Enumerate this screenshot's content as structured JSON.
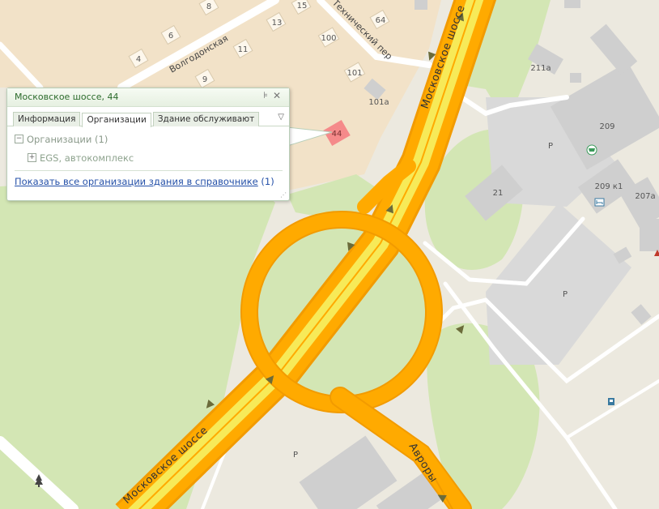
{
  "map": {
    "road_labels": {
      "moskovskoe_top": "Московское шоссе",
      "moskovskoe_bottom": "Московское шоссе",
      "avrory": "Авроры",
      "volgodonskaya": "Волгодонская",
      "tehnicheskiy": "Технический пер"
    },
    "house_numbers": [
      "8",
      "15",
      "13",
      "64",
      "6",
      "100",
      "4",
      "11",
      "101",
      "9",
      "101а",
      "44",
      "211а",
      "209",
      "21",
      "209 к1",
      "207а"
    ],
    "parking_labels": [
      "P",
      "P",
      "P"
    ],
    "colors": {
      "land": "#ece9df",
      "green_area": "#d3e6b4",
      "residential": "#f2e2c8",
      "building": "#cfcfcf",
      "highway": "#ffaa00",
      "highway_casing": "#f29b00",
      "highway_inner": "#f7ea58",
      "minor_road": "#ffffff",
      "selected_building": "#f58a8a"
    }
  },
  "popup": {
    "title": "Московское шоссе, 44",
    "pin_icon": "pin-icon",
    "close_icon": "close-icon",
    "tabs": [
      {
        "label": "Информация",
        "active": false
      },
      {
        "label": "Организации",
        "active": true
      },
      {
        "label": "Здание обслуживают",
        "active": false
      }
    ],
    "tree": {
      "group_label": "Организации (1)",
      "items": [
        {
          "label": "EGS, автокомплекс"
        }
      ]
    },
    "footer": {
      "link_text": "Показать все организации здания в справочнике",
      "count": "(1)"
    }
  }
}
